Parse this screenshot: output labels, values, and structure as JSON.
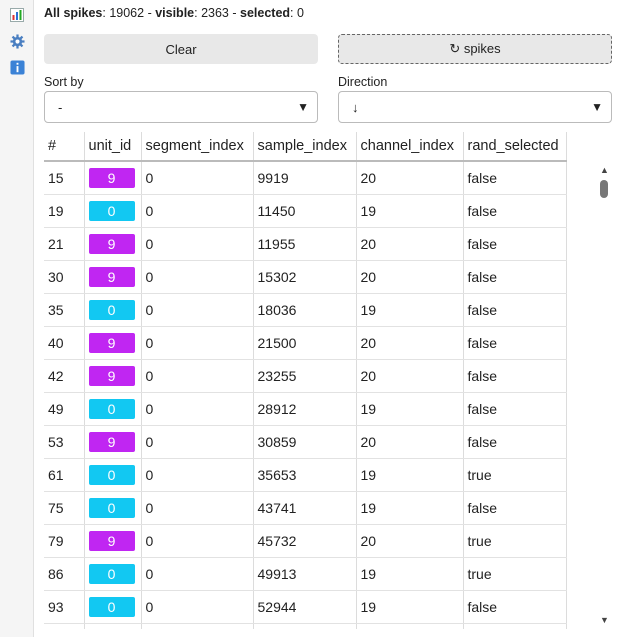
{
  "sidebar": {
    "items": [
      {
        "icon": "bar-chart-icon",
        "glyph": "📊"
      },
      {
        "icon": "gear-icon",
        "glyph": "⚙️"
      },
      {
        "icon": "info-icon",
        "glyph": "ℹ️"
      }
    ]
  },
  "summary": {
    "all_label": "All spikes",
    "all_value": "19062",
    "visible_label": "visible",
    "visible_value": "2363",
    "selected_label": "selected",
    "selected_value": "0"
  },
  "buttons": {
    "clear": "Clear",
    "spikes": "↻ spikes"
  },
  "sort": {
    "label": "Sort by",
    "value": "-"
  },
  "direction": {
    "label": "Direction",
    "value": "↓"
  },
  "dropdown_arrow": "▼",
  "scroll": {
    "up": "▲",
    "down": "▼"
  },
  "colors": {
    "unit_9": "#c026f2",
    "unit_0": "#12c8f2"
  },
  "table": {
    "headers": [
      "#",
      "unit_id",
      "segment_index",
      "sample_index",
      "channel_index",
      "rand_selected"
    ],
    "rows": [
      [
        "15",
        "9",
        "0",
        "9919",
        "20",
        "false"
      ],
      [
        "19",
        "0",
        "0",
        "11450",
        "19",
        "false"
      ],
      [
        "21",
        "9",
        "0",
        "11955",
        "20",
        "false"
      ],
      [
        "30",
        "9",
        "0",
        "15302",
        "20",
        "false"
      ],
      [
        "35",
        "0",
        "0",
        "18036",
        "19",
        "false"
      ],
      [
        "40",
        "9",
        "0",
        "21500",
        "20",
        "false"
      ],
      [
        "42",
        "9",
        "0",
        "23255",
        "20",
        "false"
      ],
      [
        "49",
        "0",
        "0",
        "28912",
        "19",
        "false"
      ],
      [
        "53",
        "9",
        "0",
        "30859",
        "20",
        "false"
      ],
      [
        "61",
        "0",
        "0",
        "35653",
        "19",
        "true"
      ],
      [
        "75",
        "0",
        "0",
        "43741",
        "19",
        "false"
      ],
      [
        "79",
        "9",
        "0",
        "45732",
        "20",
        "true"
      ],
      [
        "86",
        "0",
        "0",
        "49913",
        "19",
        "true"
      ],
      [
        "93",
        "0",
        "0",
        "52944",
        "19",
        "false"
      ],
      [
        "",
        "0",
        "",
        "",
        "",
        ""
      ]
    ]
  }
}
